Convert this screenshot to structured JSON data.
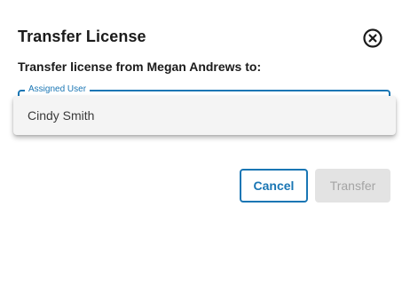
{
  "dialog": {
    "title": "Transfer License",
    "subtitle": "Transfer license from Megan Andrews to:",
    "close_icon": "close-circle-icon"
  },
  "assigned_user_field": {
    "label": "Assigned User",
    "value": ""
  },
  "dropdown": {
    "options": [
      "Cindy Smith"
    ]
  },
  "actions": {
    "cancel_label": "Cancel",
    "transfer_label": "Transfer",
    "transfer_disabled": true
  },
  "colors": {
    "accent": "#1a76b4",
    "disabled_bg": "#e3e3e3",
    "disabled_text": "#a4a4a4",
    "text": "#1b1b1b"
  }
}
